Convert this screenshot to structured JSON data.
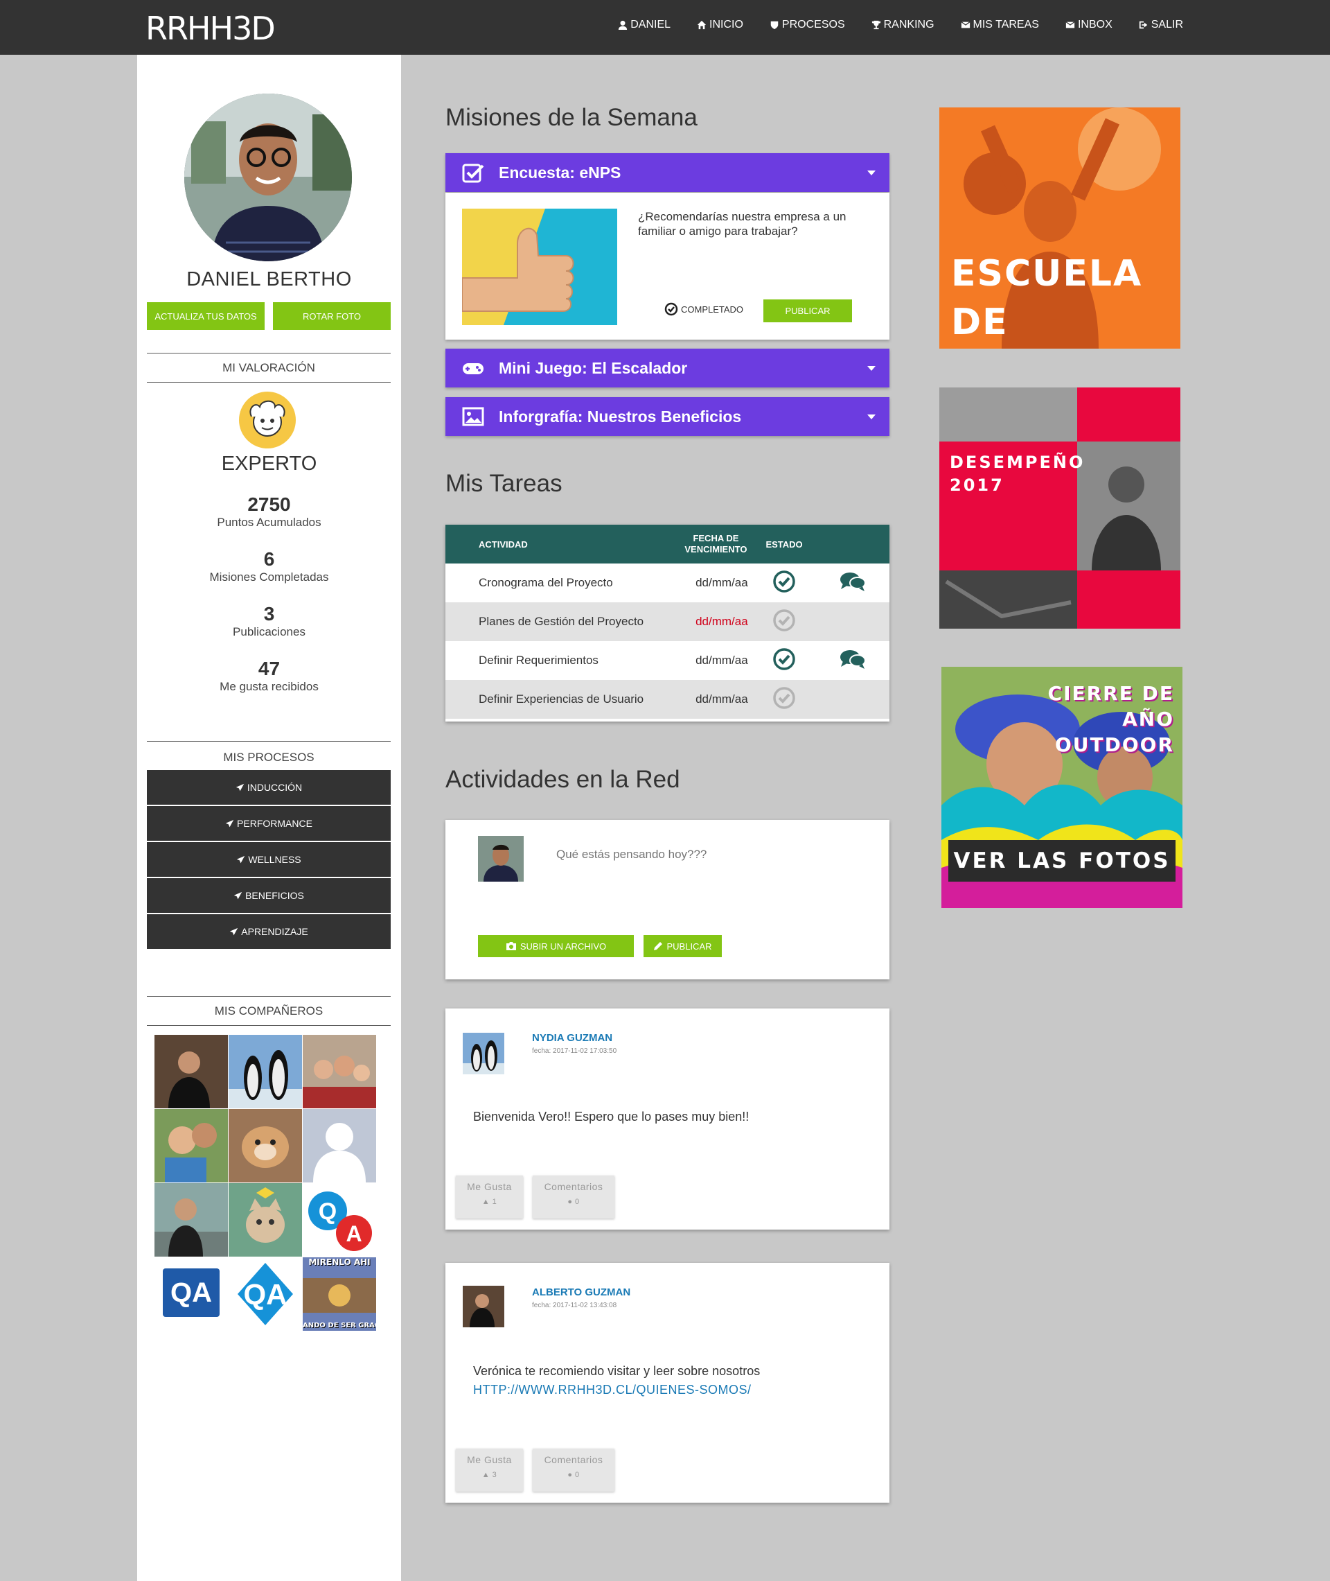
{
  "app": {
    "logo": "RRHH3D"
  },
  "nav": [
    {
      "label": "DANIEL",
      "icon": "user-icon"
    },
    {
      "label": "INICIO",
      "icon": "home-icon"
    },
    {
      "label": "PROCESOS",
      "icon": "shield-icon"
    },
    {
      "label": "RANKING",
      "icon": "trophy-icon"
    },
    {
      "label": "MIS TAREAS",
      "icon": "envelope-icon"
    },
    {
      "label": "INBOX",
      "icon": "envelope-icon"
    },
    {
      "label": "SALIR",
      "icon": "sign-out-icon"
    }
  ],
  "profile": {
    "name": "DANIEL BERTHO",
    "update_label": "ACTUALIZA TUS DATOS",
    "rotate_label": "ROTAR FOTO"
  },
  "valoracion": {
    "title": "MI VALORACIÓN",
    "level": "EXPERTO",
    "stats": [
      {
        "value": "2750",
        "label": "Puntos Acumulados"
      },
      {
        "value": "6",
        "label": "Misiones Completadas"
      },
      {
        "value": "3",
        "label": "Publicaciones"
      },
      {
        "value": "47",
        "label": "Me gusta recibidos"
      }
    ]
  },
  "procesos": {
    "title": "MIS PROCESOS",
    "items": [
      "INDUCCIÓN",
      "PERFORMANCE",
      "WELLNESS",
      "BENEFICIOS",
      "APRENDIZAJE"
    ]
  },
  "companeros": {
    "title": "MIS COMPAÑEROS",
    "overlay_top": "MIRENLO AHI",
    "overlay_bottom": "ANDO DE SER GRAC"
  },
  "misiones": {
    "title": "Misiones de la Semana",
    "items": [
      {
        "title": "Encuesta: eNPS",
        "icon": "check-square-icon"
      },
      {
        "title": "Mini Juego: El Escalador",
        "icon": "gamepad-icon"
      },
      {
        "title": "Inforgrafía: Nuestros Beneficios",
        "icon": "image-icon"
      }
    ],
    "question": "¿Recomendarías nuestra empresa a un familiar o amigo para trabajar?",
    "completed_label": "COMPLETADO",
    "publish_label": "PUBLICAR"
  },
  "tareas": {
    "title": "Mis Tareas",
    "columns": [
      "ACTIVIDAD",
      "FECHA DE VENCIMIENTO",
      "ESTADO"
    ],
    "rows": [
      {
        "activity": "Cronograma del Proyecto",
        "date": "dd/mm/aa",
        "done": true,
        "comments": true,
        "overdue": false
      },
      {
        "activity": "Planes de Gestión del Proyecto",
        "date": "dd/mm/aa",
        "done": false,
        "comments": false,
        "overdue": true
      },
      {
        "activity": "Definir Requerimientos",
        "date": "dd/mm/aa",
        "done": true,
        "comments": true,
        "overdue": false
      },
      {
        "activity": "Definir Experiencias de Usuario",
        "date": "dd/mm/aa",
        "done": false,
        "comments": false,
        "overdue": false
      }
    ]
  },
  "red": {
    "title": "Actividades en la Red",
    "placeholder": "Qué estás pensando hoy???",
    "upload_label": "SUBIR UN ARCHIVO",
    "publish_label": "PUBLICAR",
    "posts": [
      {
        "author": "NYDIA GUZMAN",
        "date": "fecha: 2017-11-02 17:03:50",
        "text": "Bienvenida Vero!! Espero que lo pases muy bien!!",
        "link": "",
        "likes_label": "Me Gusta",
        "likes": "1",
        "comments_label": "Comentarios",
        "comments": "0"
      },
      {
        "author": "ALBERTO GUZMAN",
        "date": "fecha: 2017-11-02 13:43:08",
        "text": "Verónica te recomiendo visitar y leer sobre nosotros",
        "link": "HTTP://WWW.RRHH3D.CL/QUIENES-SOMOS/",
        "likes_label": "Me Gusta",
        "likes": "3",
        "comments_label": "Comentarios",
        "comments": "0"
      }
    ]
  },
  "banners": [
    {
      "line1": "ESCUELA",
      "line2": "DE VERANO"
    },
    {
      "line1": "DESEMPEÑO",
      "line2": "2017"
    },
    {
      "line1": "CIERRE DE",
      "line2": "AÑO",
      "line3": "OUTDOOR",
      "cta": "VER LAS FOTOS"
    }
  ],
  "colors": {
    "accent_green": "#83c514",
    "mission_purple": "#6c3ce0",
    "table_header": "#23605c",
    "dark": "#333333",
    "link_blue": "#1a7ab5",
    "overdue_red": "#d0021b"
  }
}
